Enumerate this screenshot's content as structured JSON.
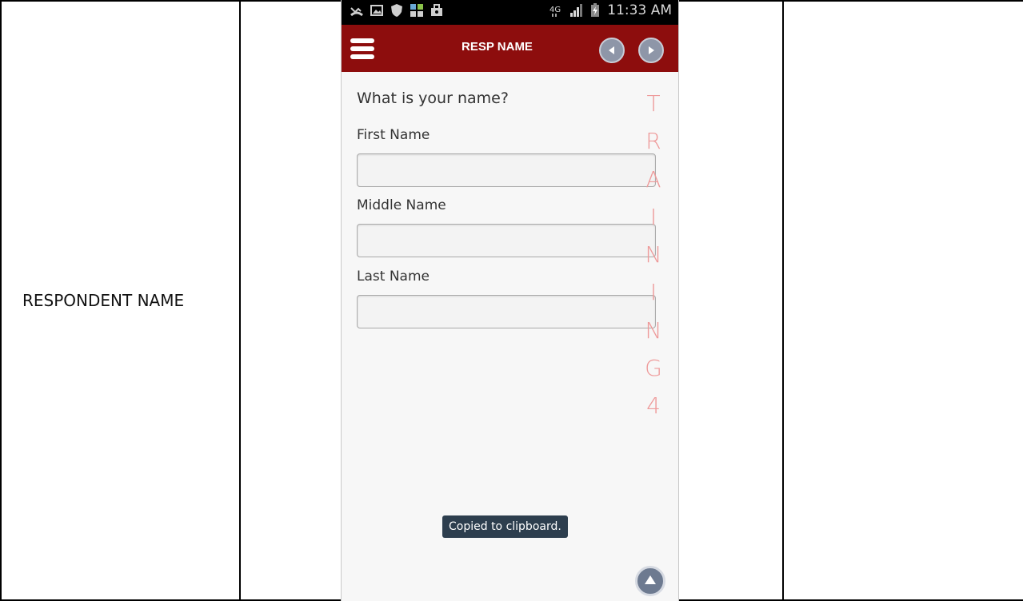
{
  "document": {
    "row_label": "RESPONDENT NAME"
  },
  "phone": {
    "status_bar": {
      "time": "11:33 AM",
      "network": "4G",
      "icons": [
        "missed-call-icon",
        "image-icon",
        "shield-icon",
        "apps-grid-icon",
        "briefcase-icon",
        "signal-icon",
        "battery-icon"
      ]
    },
    "app_bar": {
      "title": "RESP NAME",
      "color": "#8d0d0d"
    },
    "form": {
      "question": "What is your name?",
      "fields": [
        {
          "label": "First Name",
          "value": ""
        },
        {
          "label": "Middle Name",
          "value": ""
        },
        {
          "label": "Last Name",
          "value": ""
        }
      ]
    },
    "watermark": [
      "T",
      "R",
      "A",
      "I",
      "N",
      "I",
      "N",
      "G",
      "4"
    ],
    "toast": "Copied to clipboard."
  }
}
